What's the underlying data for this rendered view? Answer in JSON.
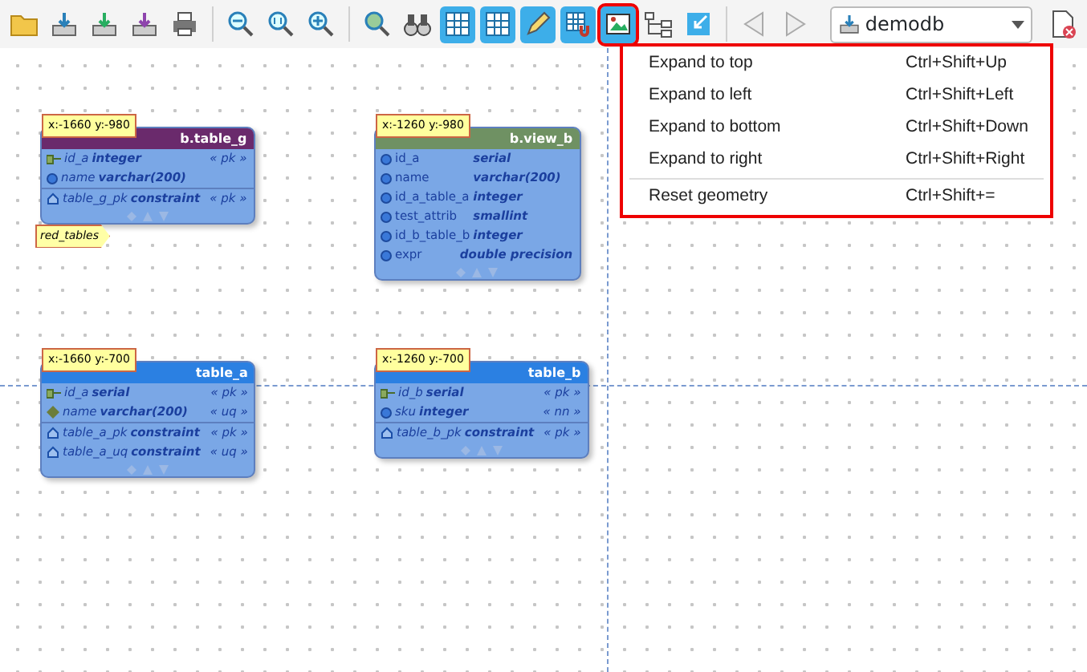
{
  "toolbar": {
    "tools": [
      {
        "kind": "folder",
        "on": false
      },
      {
        "kind": "tray",
        "on": false
      },
      {
        "kind": "tray-green",
        "on": false
      },
      {
        "kind": "tray-purple",
        "on": false
      },
      {
        "kind": "printer",
        "on": false
      },
      {
        "kind": "sep"
      },
      {
        "kind": "zoom-out",
        "on": false
      },
      {
        "kind": "zoom-reset",
        "on": false
      },
      {
        "kind": "zoom-in",
        "on": false
      },
      {
        "kind": "sep"
      },
      {
        "kind": "zoom-globe",
        "on": false
      },
      {
        "kind": "binoculars",
        "on": false
      },
      {
        "kind": "grid",
        "on": true
      },
      {
        "kind": "grid",
        "on": true
      },
      {
        "kind": "pencil",
        "on": true
      },
      {
        "kind": "grid-magnet",
        "on": true
      },
      {
        "kind": "picture",
        "on": true
      },
      {
        "kind": "tree",
        "on": false
      },
      {
        "kind": "shrink",
        "on": false
      },
      {
        "kind": "sep"
      },
      {
        "kind": "back",
        "on": false
      },
      {
        "kind": "forward",
        "on": false
      }
    ],
    "database": "demodb"
  },
  "menu": [
    {
      "label": "Expand to top",
      "shortcut": "Ctrl+Shift+Up",
      "separator_before": false
    },
    {
      "label": "Expand to left",
      "shortcut": "Ctrl+Shift+Left",
      "separator_before": false
    },
    {
      "label": "Expand to bottom",
      "shortcut": "Ctrl+Shift+Down",
      "separator_before": false
    },
    {
      "label": "Expand to right",
      "shortcut": "Ctrl+Shift+Right",
      "separator_before": false
    },
    {
      "label": "Reset geometry",
      "shortcut": "Ctrl+Shift+=",
      "separator_before": true
    }
  ],
  "canvas": {
    "tables": [
      {
        "kind": "table",
        "title": "b.table_g",
        "color": "#6a2a6c",
        "position": "x:-1660 y:-980",
        "tag": "red_tables",
        "columns": [
          {
            "kind": "pk",
            "name": "id_a",
            "type": "integer",
            "tag": "« pk »"
          },
          {
            "kind": "column",
            "name": "name",
            "type": "varchar(200)"
          }
        ],
        "constraints": [
          {
            "name": "table_g_pk",
            "type": "constraint",
            "tag": "« pk »"
          }
        ]
      },
      {
        "kind": "view",
        "title": "b.view_b",
        "color": "#6f9163",
        "position": "x:-1260 y:-980",
        "columns": [
          {
            "kind": "column",
            "name": "id_a",
            "type": "serial"
          },
          {
            "kind": "column",
            "name": "name",
            "type": "varchar(200)"
          },
          {
            "kind": "column",
            "name": "id_a_table_a",
            "type": "integer"
          },
          {
            "kind": "column",
            "name": "test_attrib",
            "type": "smallint"
          },
          {
            "kind": "column",
            "name": "id_b_table_b",
            "type": "integer"
          },
          {
            "kind": "column",
            "name": "expr",
            "type": "double precision"
          }
        ]
      },
      {
        "kind": "table",
        "title": "table_a",
        "color": "#2b80e2",
        "position": "x:-1660 y:-700",
        "columns": [
          {
            "kind": "pk",
            "name": "id_a",
            "type": "serial",
            "tag": "« pk »"
          },
          {
            "kind": "uq",
            "name": "name",
            "type": "varchar(200)",
            "tag": "« uq »"
          }
        ],
        "constraints": [
          {
            "name": "table_a_pk",
            "type": "constraint",
            "tag": "« pk »"
          },
          {
            "name": "table_a_uq",
            "type": "constraint",
            "tag": "« uq »"
          }
        ]
      },
      {
        "kind": "table",
        "title": "table_b",
        "color": "#2b80e2",
        "position": "x:-1260 y:-700",
        "columns": [
          {
            "kind": "pk",
            "name": "id_b",
            "type": "serial",
            "tag": "« pk »"
          },
          {
            "kind": "column",
            "name": "sku",
            "type": "integer",
            "tag": "« nn »"
          }
        ],
        "constraints": [
          {
            "name": "table_b_pk",
            "type": "constraint",
            "tag": "« pk »"
          }
        ]
      }
    ]
  }
}
